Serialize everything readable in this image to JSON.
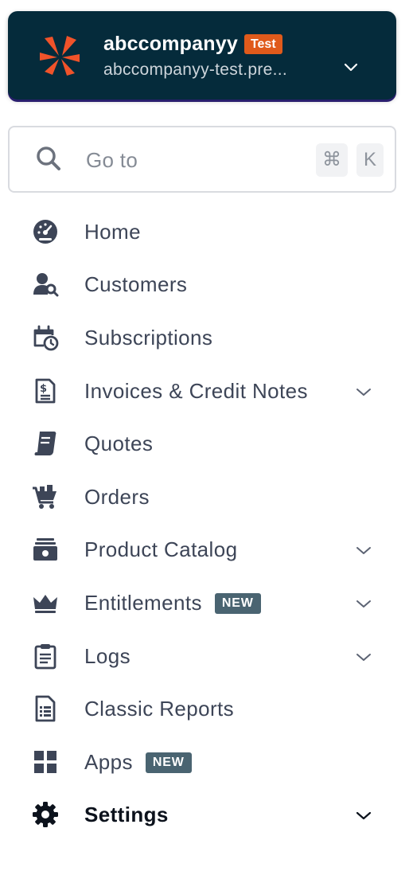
{
  "account": {
    "name": "abccompanyy",
    "env_badge": "Test",
    "domain": "abccompanyy-test.pre...",
    "logo_icon": "chargebee-logo-icon",
    "accent_color": "#e05a1b",
    "bg_color": "#052b3b"
  },
  "search": {
    "placeholder": "Go to",
    "shortcut_cmd": "⌘",
    "shortcut_key": "K"
  },
  "nav": {
    "items": [
      {
        "label": "Home",
        "icon": "dashboard-gauge-icon",
        "expandable": false
      },
      {
        "label": "Customers",
        "icon": "customers-icon",
        "expandable": false
      },
      {
        "label": "Subscriptions",
        "icon": "calendar-clock-icon",
        "expandable": false
      },
      {
        "label": "Invoices & Credit Notes",
        "icon": "invoice-dollar-icon",
        "expandable": true
      },
      {
        "label": "Quotes",
        "icon": "quote-scroll-icon",
        "expandable": false
      },
      {
        "label": "Orders",
        "icon": "shopping-cart-icon",
        "expandable": false
      },
      {
        "label": "Product Catalog",
        "icon": "product-box-icon",
        "expandable": true
      },
      {
        "label": "Entitlements",
        "icon": "crown-icon",
        "expandable": true,
        "badge": "NEW"
      },
      {
        "label": "Logs",
        "icon": "clipboard-icon",
        "expandable": true
      },
      {
        "label": "Classic Reports",
        "icon": "report-document-icon",
        "expandable": false
      },
      {
        "label": "Apps",
        "icon": "apps-grid-icon",
        "expandable": false,
        "badge": "NEW"
      },
      {
        "label": "Settings",
        "icon": "gear-icon",
        "expandable": true,
        "active": true
      }
    ]
  }
}
